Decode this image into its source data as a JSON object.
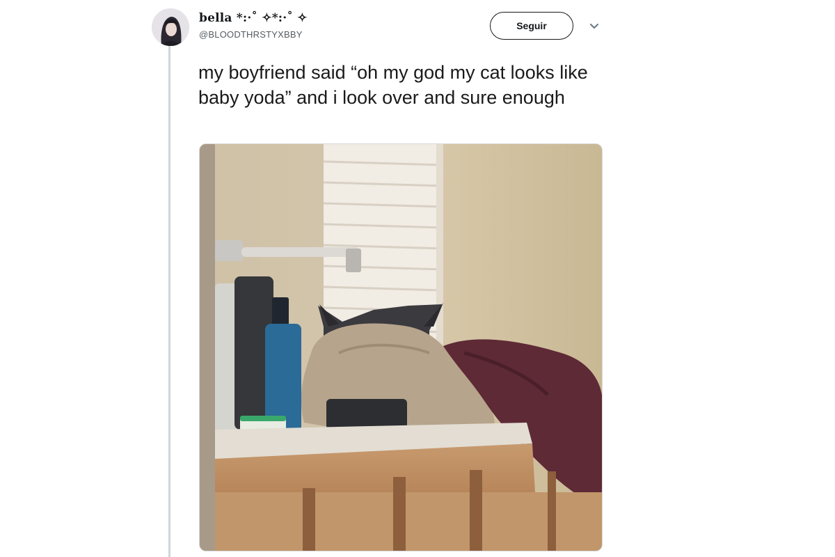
{
  "tweet": {
    "display_name": "bella *:·˚ ✧*:·˚ ✧",
    "handle": "@BLOODTHRSTYXBBY",
    "text": "my boyfriend said “oh my god my cat looks like baby yoda” and i look over and sure enough"
  },
  "actions": {
    "follow_label": "Seguir",
    "menu_icon": "chevron-down-icon"
  },
  "media": {
    "kind": "photo",
    "subject": "grey cat peeking over towels on a bathroom counter"
  },
  "colors": {
    "text": "#14171a",
    "secondary": "#555b61",
    "thread_line": "#ccd6dd"
  }
}
